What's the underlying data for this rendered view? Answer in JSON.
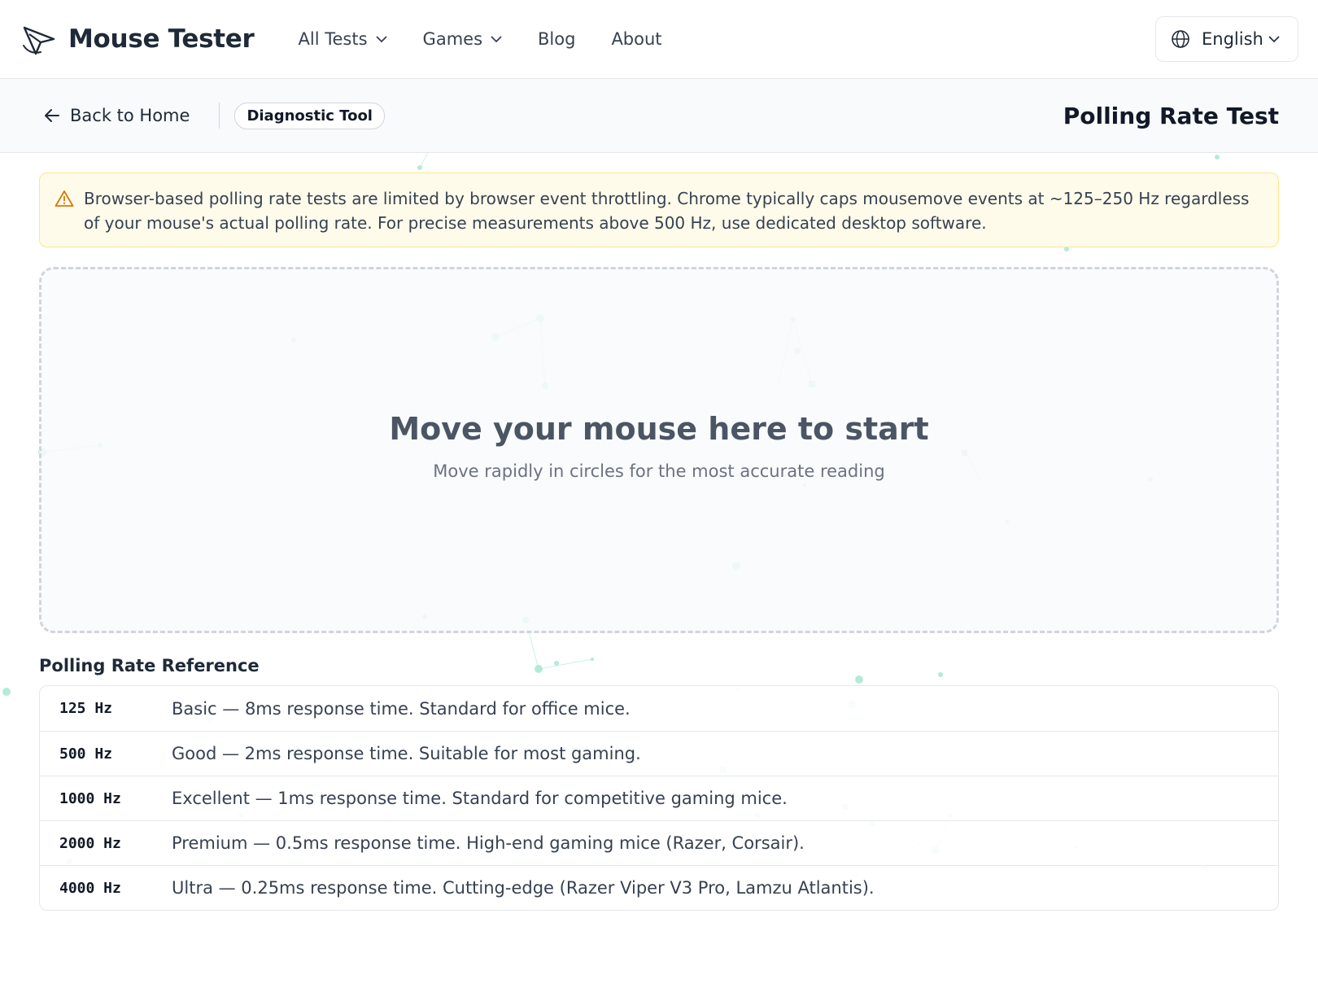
{
  "header": {
    "brand": "Mouse Tester",
    "nav": [
      {
        "label": "All Tests",
        "dropdown": true
      },
      {
        "label": "Games",
        "dropdown": true
      },
      {
        "label": "Blog",
        "dropdown": false
      },
      {
        "label": "About",
        "dropdown": false
      }
    ],
    "language": "English"
  },
  "subheader": {
    "back_label": "Back to Home",
    "badge": "Diagnostic Tool",
    "title": "Polling Rate Test"
  },
  "warning": {
    "text": "Browser-based polling rate tests are limited by browser event throttling. Chrome typically caps mousemove events at ~125–250 Hz regardless of your mouse's actual polling rate. For precise measurements above 500 Hz, use dedicated desktop software."
  },
  "test_area": {
    "title": "Move your mouse here to start",
    "subtitle": "Move rapidly in circles for the most accurate reading"
  },
  "reference": {
    "title": "Polling Rate Reference",
    "rows": [
      {
        "hz": "125 Hz",
        "desc": "Basic — 8ms response time. Standard for office mice."
      },
      {
        "hz": "500 Hz",
        "desc": "Good — 2ms response time. Suitable for most gaming."
      },
      {
        "hz": "1000 Hz",
        "desc": "Excellent — 1ms response time. Standard for competitive gaming mice."
      },
      {
        "hz": "2000 Hz",
        "desc": "Premium — 0.5ms response time. High-end gaming mice (Razer, Corsair)."
      },
      {
        "hz": "4000 Hz",
        "desc": "Ultra — 0.25ms response time. Cutting-edge (Razer Viper V3 Pro, Lamzu Atlantis)."
      }
    ]
  },
  "colors": {
    "accent_dots": "#a7e8cf",
    "warning_border": "#fde68a",
    "warning_icon": "#d97706"
  }
}
